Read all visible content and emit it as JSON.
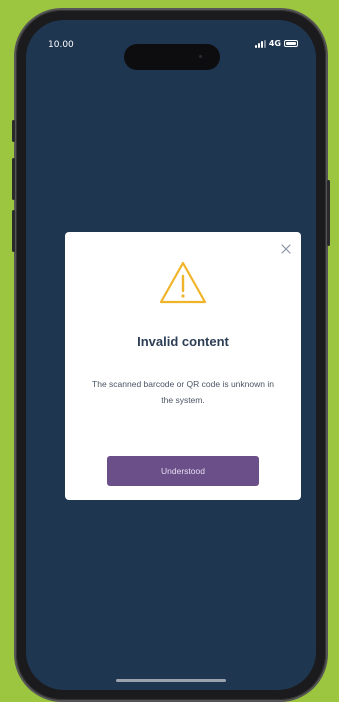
{
  "status_bar": {
    "time": "10.00",
    "network": "4G",
    "signal_icon": "signal-bars-icon",
    "battery_icon": "battery-icon"
  },
  "dialog": {
    "icon": "warning-triangle-icon",
    "close_icon": "close-icon",
    "title": "Invalid content",
    "message": "The scanned barcode or QR code is unknown in the system.",
    "button_label": "Understood"
  },
  "colors": {
    "background": "#9cc63f",
    "screen": "#1f3651",
    "warning": "#f0b42a",
    "button": "#6a4f89"
  }
}
